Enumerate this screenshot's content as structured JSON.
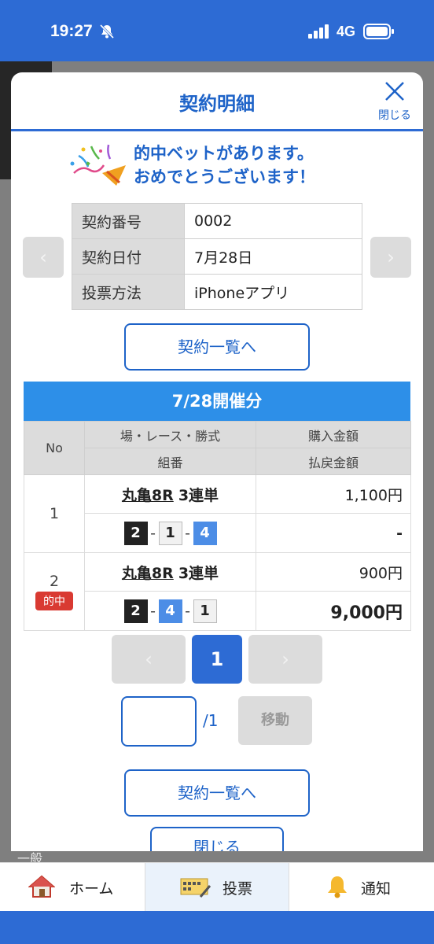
{
  "status": {
    "time": "19:27",
    "network": "4G"
  },
  "backdrop": {
    "label": "一般"
  },
  "modal": {
    "title": "契約明細",
    "close_label": "閉じる",
    "hit_message_line1": "的中ベットがあります。",
    "hit_message_line2": "おめでとうございます！",
    "prev_arrow": "‹",
    "next_arrow": "›",
    "contract": [
      {
        "key": "契約番号",
        "value": "0002"
      },
      {
        "key": "契約日付",
        "value": "7月28日"
      },
      {
        "key": "投票方法",
        "value": "iPhoneアプリ"
      }
    ],
    "list_button": "契約一覧へ",
    "day_banner": "7/28開催分",
    "table_headers": {
      "no": "No",
      "race": "場・レース・勝式",
      "numbers": "組番",
      "purchase": "購入金額",
      "payout": "払戻金額"
    },
    "bets": [
      {
        "no": "1",
        "race": "丸亀8R",
        "type": "3連単",
        "nums": [
          "2",
          "1",
          "4"
        ],
        "purchase": "1,100円",
        "payout": "-",
        "hit": ""
      },
      {
        "no": "2",
        "race": "丸亀8R",
        "type": "3連単",
        "nums": [
          "2",
          "4",
          "1"
        ],
        "purchase": "900円",
        "payout": "9,000円",
        "hit": "的中"
      }
    ],
    "pagination": {
      "prev": "‹",
      "current": "1",
      "next": "›",
      "total": "/1",
      "move_label": "移動"
    },
    "list_button2": "契約一覧へ",
    "close_button": "閉じる"
  },
  "tabbar": {
    "home": "ホーム",
    "vote": "投票",
    "notify": "通知"
  },
  "colors": {
    "primary": "#2d6bd4",
    "accent_blue": "#1e63c8",
    "banner": "#2d8fe8",
    "hit_red": "#d93a32"
  }
}
